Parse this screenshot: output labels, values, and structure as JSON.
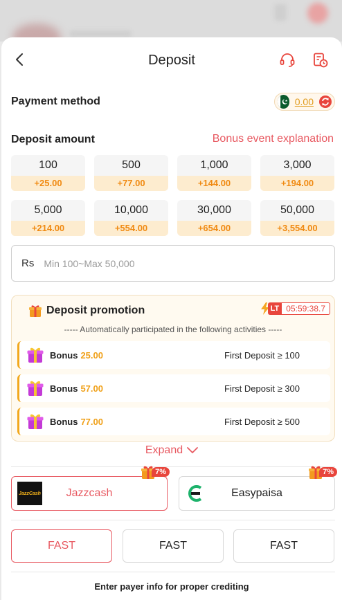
{
  "header": {
    "title": "Deposit",
    "back_icon": "chevron-left-icon",
    "support_icon": "headset-icon",
    "history_icon": "record-clock-icon"
  },
  "payment_method": {
    "label": "Payment method",
    "balance": "0.00",
    "flag": "pakistan-flag-icon",
    "refresh_icon": "refresh-icon"
  },
  "deposit_amount": {
    "label": "Deposit amount",
    "bonus_link": "Bonus event explanation",
    "options": [
      {
        "value": "100",
        "bonus": "+25.00"
      },
      {
        "value": "500",
        "bonus": "+77.00"
      },
      {
        "value": "1,000",
        "bonus": "+144.00"
      },
      {
        "value": "3,000",
        "bonus": "+194.00"
      },
      {
        "value": "5,000",
        "bonus": "+214.00"
      },
      {
        "value": "10,000",
        "bonus": "+554.00"
      },
      {
        "value": "30,000",
        "bonus": "+654.00"
      },
      {
        "value": "50,000",
        "bonus": "+3,554.00"
      }
    ],
    "currency": "Rs",
    "placeholder": "Min 100~Max 50,000"
  },
  "promotion": {
    "title": "Deposit promotion",
    "badge": "LT",
    "timer": "05:59:38.7",
    "subtitle": "----- Automatically participated in the following activities -----",
    "rows": [
      {
        "label": "Bonus",
        "amount": "25.00",
        "condition": "First Deposit ≥ 100"
      },
      {
        "label": "Bonus",
        "amount": "57.00",
        "condition": "First Deposit ≥ 300"
      },
      {
        "label": "Bonus",
        "amount": "77.00",
        "condition": "First Deposit ≥ 500"
      }
    ],
    "expand": "Expand"
  },
  "channels": [
    {
      "name": "Jazzcash",
      "tag": "7%",
      "logo_text": "JazzCash"
    },
    {
      "name": "Easypaisa",
      "tag": "7%"
    }
  ],
  "speeds": [
    "FAST",
    "FAST",
    "FAST"
  ],
  "payer_note": "Enter payer info for proper crediting",
  "colors": {
    "accent": "#e85a62",
    "bonus": "#f08a12",
    "bonus_bg": "#fdeccf"
  }
}
